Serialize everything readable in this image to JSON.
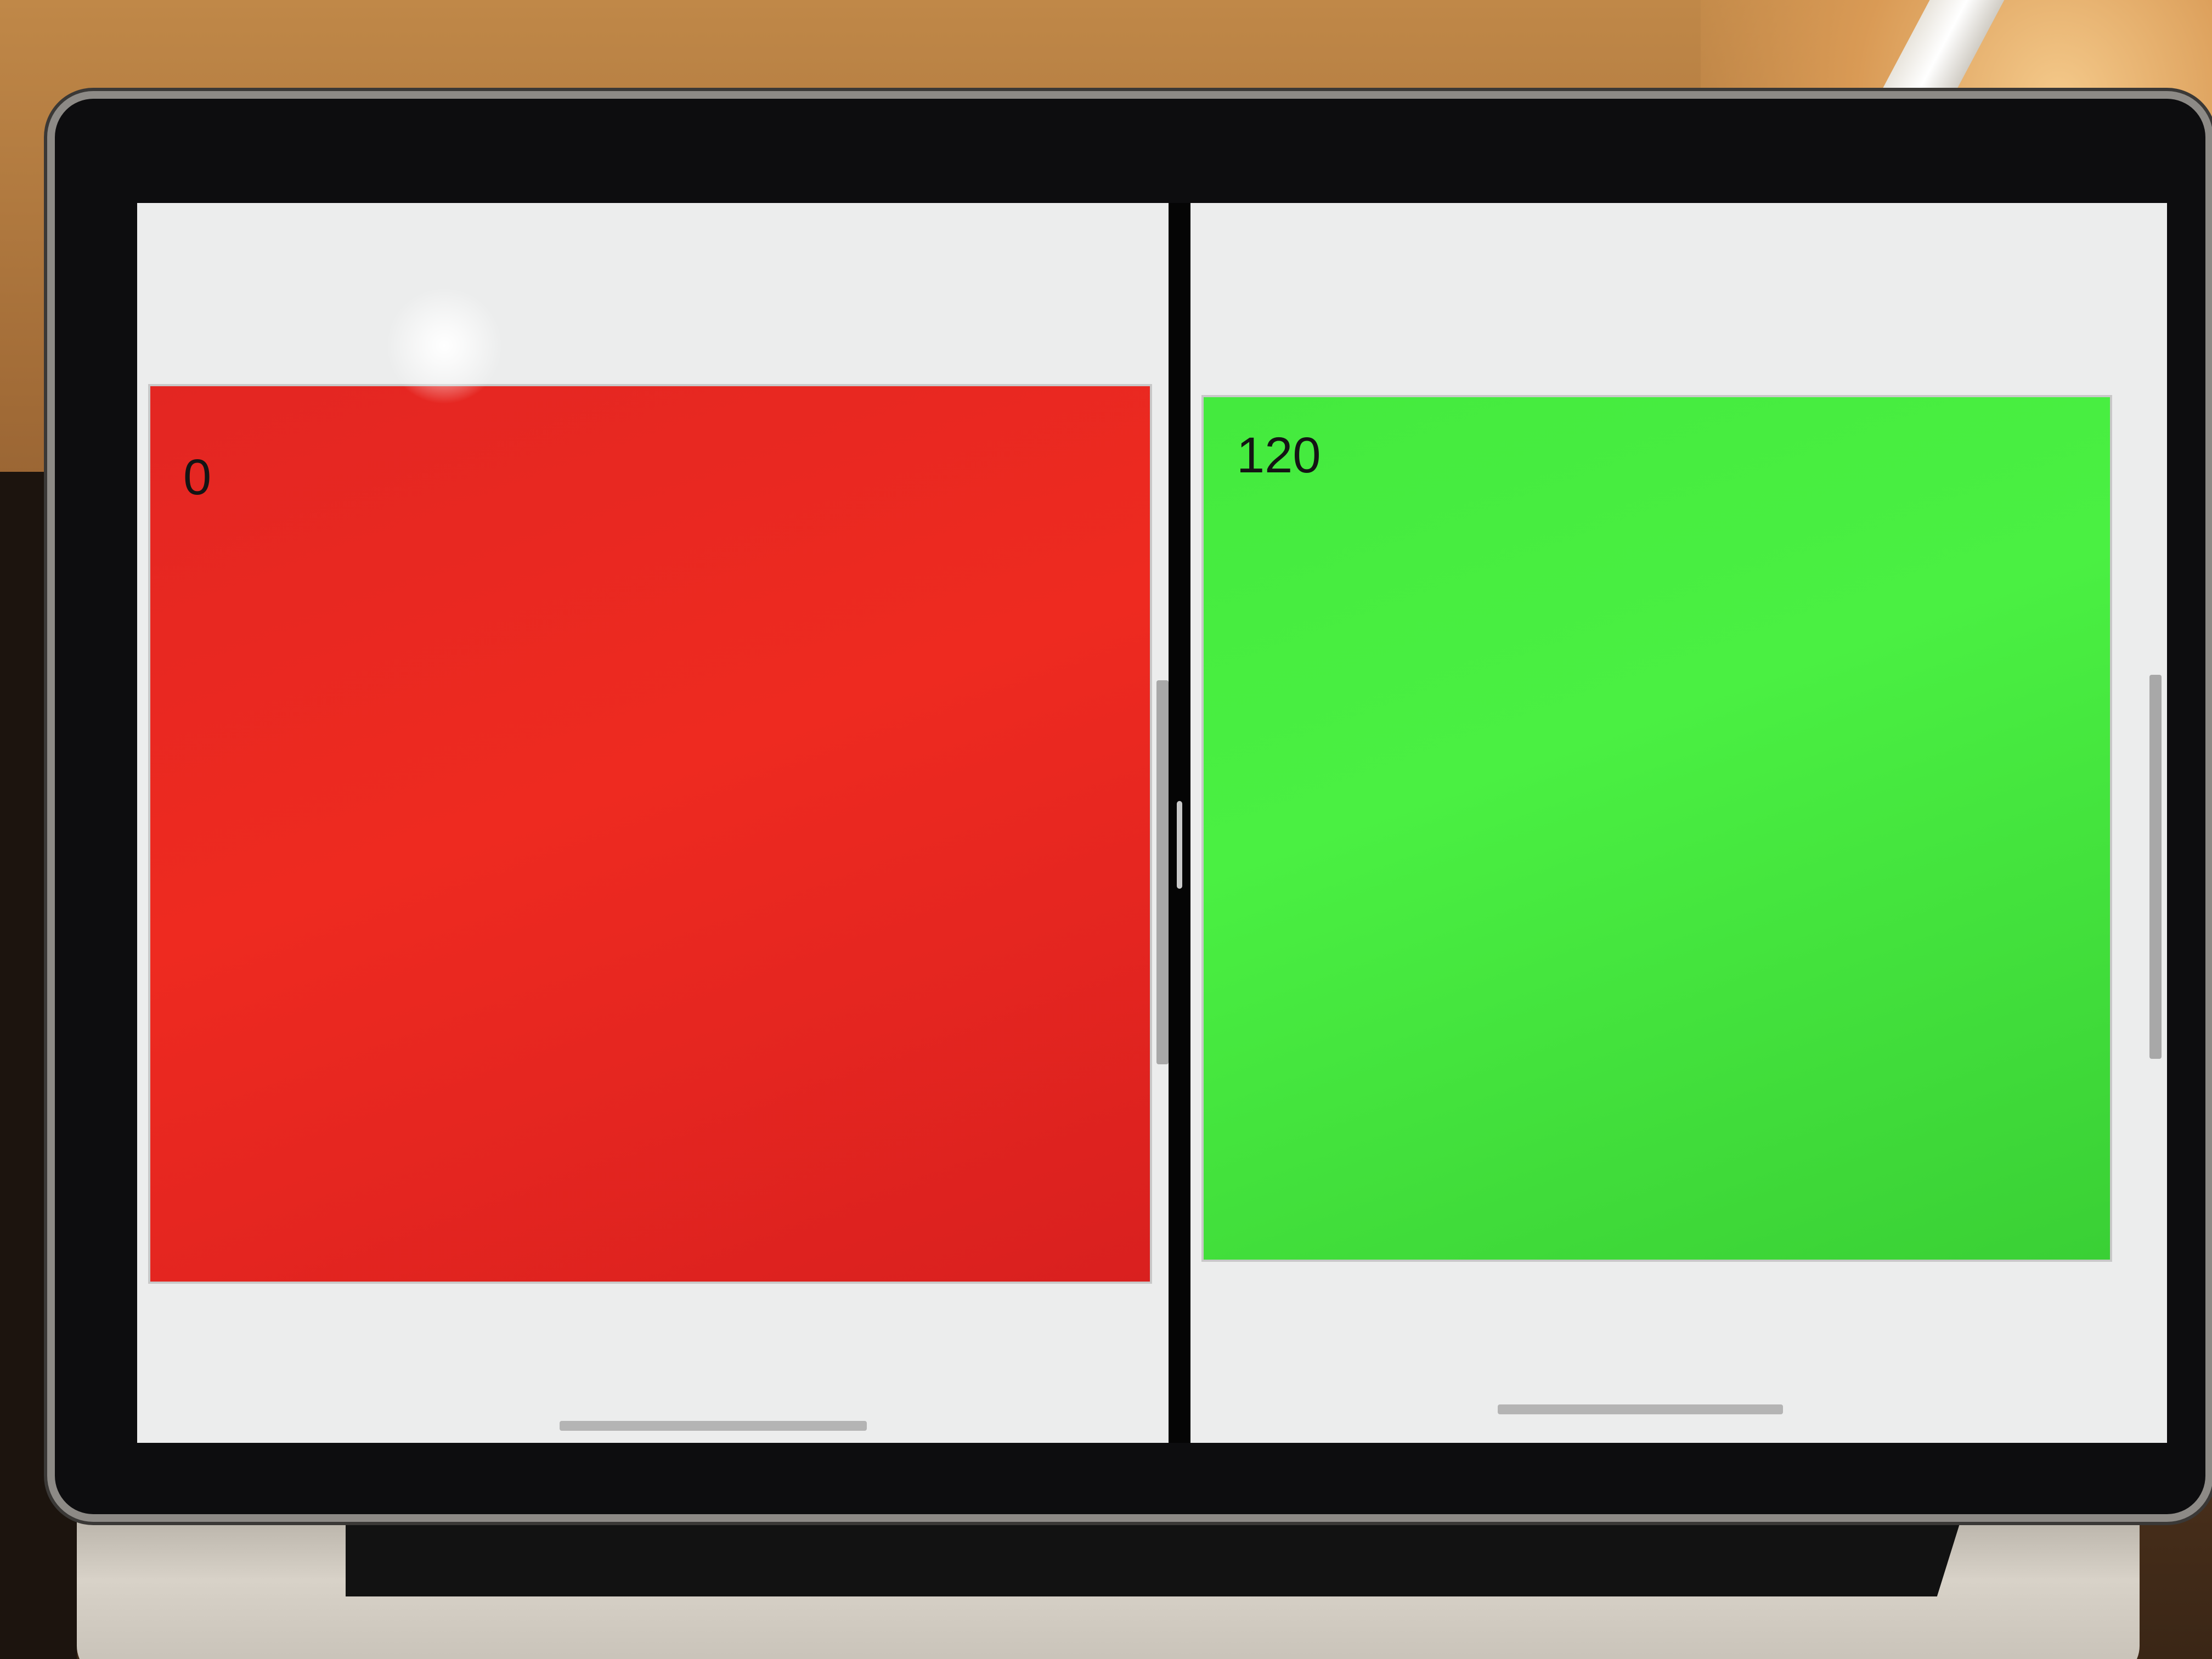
{
  "panes": {
    "left": {
      "label": "0",
      "color": "#e4251f"
    },
    "right": {
      "label": "120",
      "color": "#46ec3f"
    }
  },
  "colors": {
    "pane_background": "#eceded",
    "divider": "#050505",
    "bezel": "#0d0d0f"
  }
}
